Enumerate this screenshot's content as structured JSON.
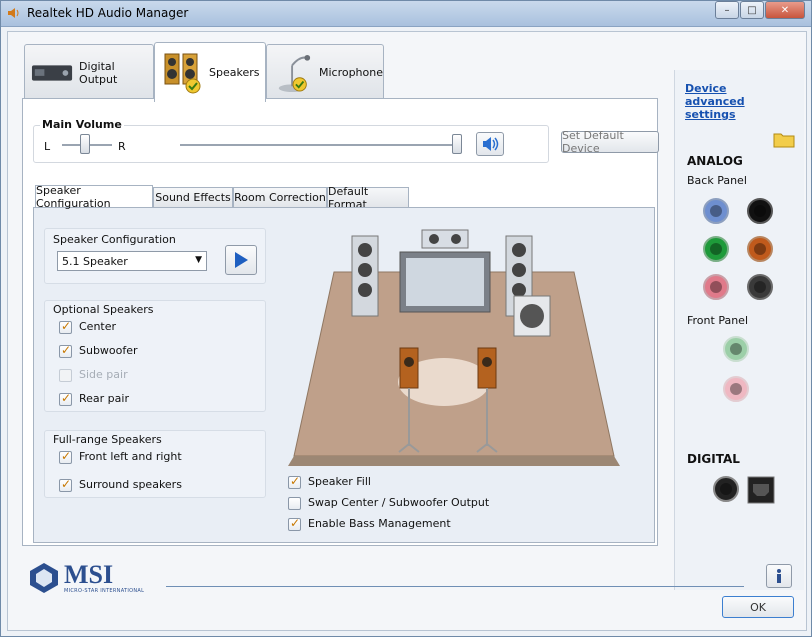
{
  "window": {
    "title": "Realtek HD Audio Manager",
    "controls": {
      "minimize": "–",
      "maximize": "□",
      "close": "✕"
    }
  },
  "top_tabs": [
    {
      "label": "Digital Output",
      "icon": "digital-output-icon"
    },
    {
      "label": "Speakers",
      "icon": "speakers-icon",
      "active": true
    },
    {
      "label": "Microphone",
      "icon": "microphone-icon"
    }
  ],
  "volume": {
    "title": "Main Volume",
    "left_label": "L",
    "right_label": "R",
    "balance_level": 0.5,
    "volume_level": 1.0,
    "set_default_label": "Set Default Device"
  },
  "sub_tabs": [
    {
      "label": "Speaker Configuration",
      "active": true
    },
    {
      "label": "Sound Effects"
    },
    {
      "label": "Room Correction"
    },
    {
      "label": "Default Format"
    }
  ],
  "speaker_config": {
    "title": "Speaker Configuration",
    "selected": "5.1 Speaker"
  },
  "optional_speakers": {
    "title": "Optional Speakers",
    "items": [
      {
        "label": "Center",
        "checked": true
      },
      {
        "label": "Subwoofer",
        "checked": true
      },
      {
        "label": "Side pair",
        "checked": false,
        "disabled": true
      },
      {
        "label": "Rear pair",
        "checked": true
      }
    ]
  },
  "fullrange_speakers": {
    "title": "Full-range Speakers",
    "items": [
      {
        "label": "Front left and right",
        "checked": true
      },
      {
        "label": "Surround speakers",
        "checked": true
      }
    ]
  },
  "bottom_options": [
    {
      "label": "Speaker Fill",
      "checked": true
    },
    {
      "label": "Swap Center / Subwoofer Output",
      "checked": false
    },
    {
      "label": "Enable Bass Management",
      "checked": true
    }
  ],
  "side_panel": {
    "device_link": "Device advanced settings",
    "analog_title": "ANALOG",
    "back_panel": "Back Panel",
    "front_panel": "Front Panel",
    "digital_title": "DIGITAL"
  },
  "footer": {
    "brand": "MSI",
    "brand_sub": "MICRO-STAR INTERNATIONAL",
    "ok_label": "OK"
  },
  "colors": {
    "accent": "#1651b0",
    "jack_blue": "#6e8fd0",
    "jack_green": "#1e9a3a",
    "jack_orange": "#c05a1c",
    "jack_pink": "#e07a8a"
  }
}
